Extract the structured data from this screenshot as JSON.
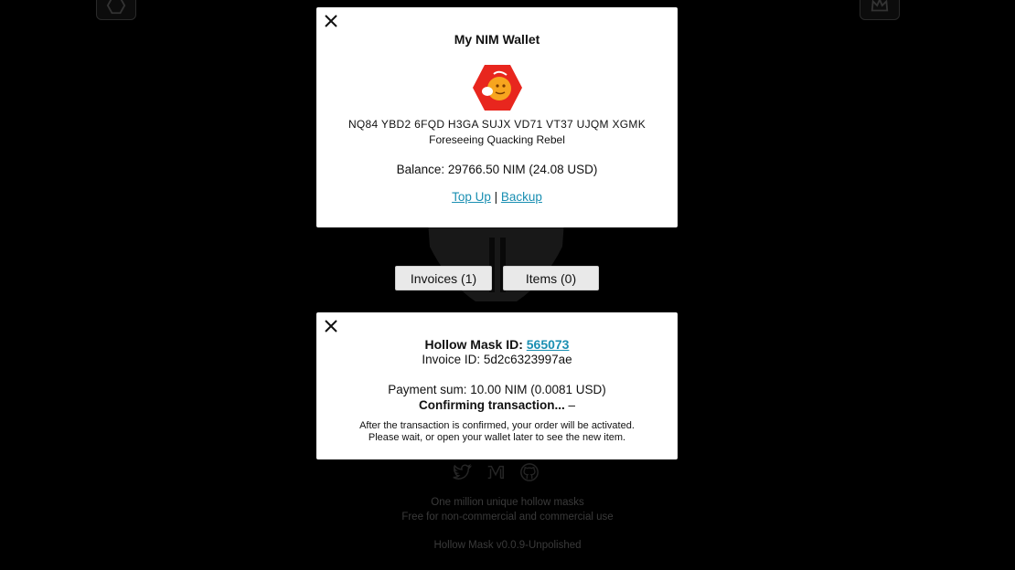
{
  "wallet_modal": {
    "title": "My NIM Wallet",
    "address": "NQ84 YBD2 6FQD H3GA SUJX VD71 VT37 UJQM XGMK",
    "label": "Foreseeing Quacking Rebel",
    "balance": "Balance: 29766.50 NIM (24.08 USD)",
    "top_up_label": "Top Up",
    "separator": "|",
    "backup_label": "Backup"
  },
  "tabs": {
    "invoices_label": "Invoices (1)",
    "items_label": "Items (0)"
  },
  "invoice_modal": {
    "mask_id_prefix": "Hollow Mask ID: ",
    "mask_id": "565073",
    "invoice_id": "Invoice ID: 5d2c6323997ae",
    "payment_sum": "Payment sum: 10.00 NIM (0.0081 USD)",
    "status": "Confirming transaction...",
    "status_suffix": " –",
    "note_line1": "After the transaction is confirmed, your order will be activated.",
    "note_line2": "Please wait, or open your wallet later to see the new item."
  },
  "footer": {
    "line1": "One million unique hollow masks",
    "line2": "Free for non-commercial and commercial use",
    "version": "Hollow Mask v0.0.9-Unpolished"
  },
  "icons": {
    "top_left": "hexagon-icon",
    "top_right": "crown-icon",
    "social": [
      "twitter-icon",
      "medium-icon",
      "github-icon"
    ]
  },
  "colors": {
    "link": "#1a8fb2",
    "identicon_bg": "#e8261e",
    "identicon_face": "#f7a51f"
  }
}
